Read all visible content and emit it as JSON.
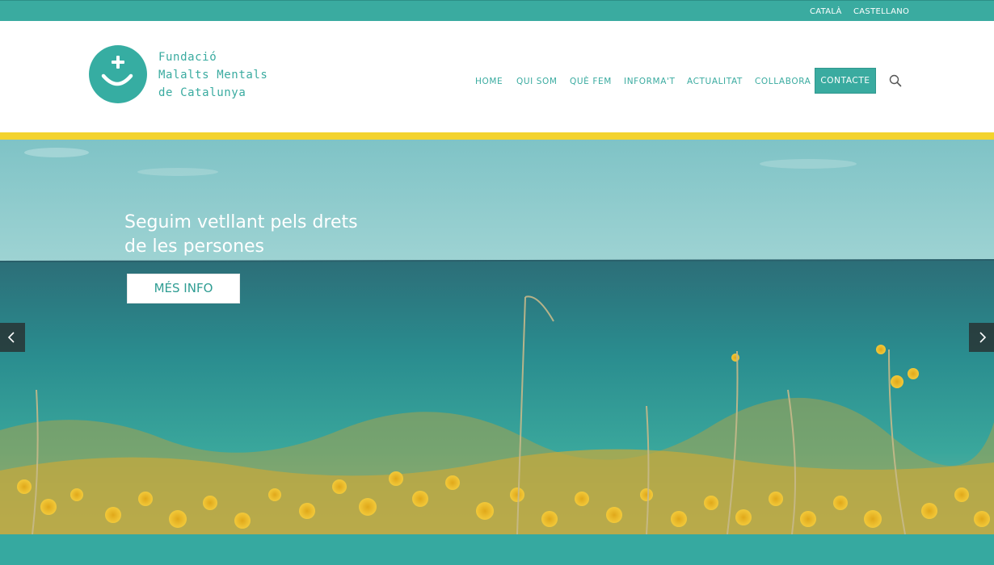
{
  "languages": [
    "CATALÀ",
    "CASTELLANO"
  ],
  "logo": {
    "lines": [
      "Fundació",
      "Malalts Mentals",
      "de Catalunya"
    ]
  },
  "nav": {
    "items": [
      "HOME",
      "QUI SOM",
      "QUÈ FEM",
      "INFORMA'T",
      "ACTUALITAT",
      "COLLABORA"
    ],
    "contact_label": "CONTACTE"
  },
  "hero": {
    "title_lines": [
      "Seguim vetllant pels drets",
      "de les persones"
    ],
    "button_label": "MÉS INFO"
  },
  "icons": {
    "search": "search-icon",
    "prev": "chevron-left-icon",
    "next": "chevron-right-icon"
  },
  "colors": {
    "brand_teal": "#3aaba0",
    "accent_yellow": "#f3d32e",
    "white": "#ffffff"
  }
}
